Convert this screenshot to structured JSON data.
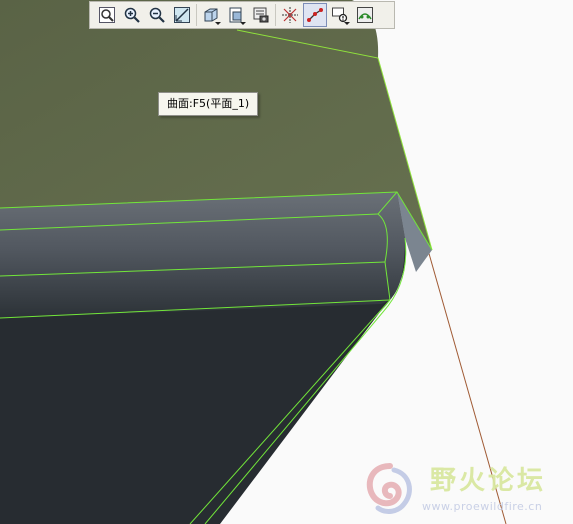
{
  "toolbar": {
    "buttons": [
      {
        "icon": "refit-zoom-icon",
        "active": false
      },
      {
        "icon": "zoom-in-icon",
        "active": false
      },
      {
        "icon": "zoom-out-icon",
        "active": false
      },
      {
        "icon": "reorient-icon",
        "active": false
      },
      {
        "icon": "display-style-icon",
        "active": false
      },
      {
        "icon": "saved-views-icon",
        "active": false
      },
      {
        "icon": "layers-icon",
        "active": false
      },
      {
        "icon": "datum-display-icon",
        "active": false
      },
      {
        "icon": "selection-filter-icon",
        "active": true
      },
      {
        "icon": "query-select-icon",
        "active": false
      },
      {
        "icon": "appearance-icon",
        "active": false
      }
    ]
  },
  "tooltip": {
    "text": "曲面:F5(平面_1)"
  },
  "watermark": {
    "title": "野火论坛",
    "url": "www.proewildfire.cn"
  },
  "colors": {
    "surface_top": "#5f6a48",
    "model_dark": "#272c31",
    "edge_highlight": "#7cf03a",
    "datum_line": "#a0522d",
    "background": "#fafafa"
  }
}
